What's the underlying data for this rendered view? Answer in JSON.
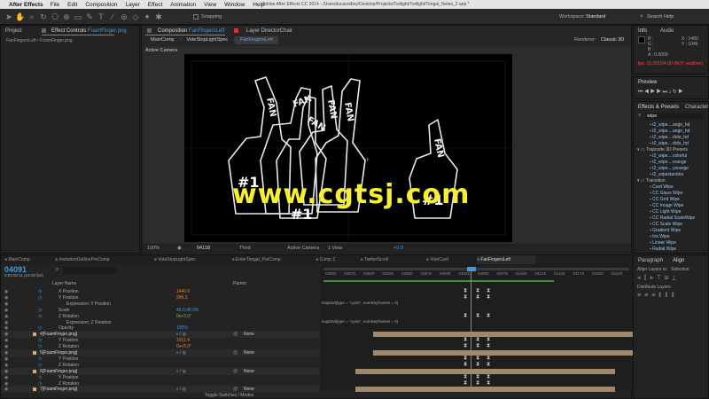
{
  "menubar": {
    "app": "After Effects",
    "items": [
      "File",
      "Edit",
      "Composition",
      "Layer",
      "Effect",
      "Animation",
      "View",
      "Window",
      "Help"
    ],
    "title": "Adobe After Effects CC 2014 - /Users/lucasridley/Desktop/Projects/Twilight/Twilight/Tongal_Notes_2.aep *"
  },
  "toolbar": {
    "snapping": "Snapping",
    "workspace_label": "Workspace:",
    "workspace_value": "Standard",
    "search_placeholder": "Search Help"
  },
  "project": {
    "tab": "Project",
    "effect_tab": "Effect Controls",
    "effect_target": "FoamFinger.png",
    "subtitle": "FanFingersLeft • FoamFinger.png"
  },
  "composition": {
    "tab": "Composition",
    "tab_name": "FanFingersLeft",
    "layer_tab": "Layer DirectorChair",
    "breadcrumbs": [
      "MainComp",
      "VoteStopLightSpec",
      "FanFingersLeft"
    ],
    "renderer_label": "Renderer:",
    "renderer_value": "Classic 3D",
    "active_camera": "Active Camera",
    "viewer_words": [
      "FAN",
      "FAN",
      "FAN",
      "FAN",
      "FAN",
      "FAN"
    ],
    "watermark": "www.cgtsj.com",
    "footer": {
      "zoom": "100%",
      "timecode": "04118",
      "resolution": "Third",
      "camera": "Active Camera",
      "view": "1 View",
      "exposure": "+0.0"
    }
  },
  "info": {
    "tab": "Info",
    "audio_tab": "Audio",
    "r": "R :",
    "g": "G :",
    "b": "B :",
    "a": "A : 0.0000",
    "x": "X : 1480",
    "y": "Y : 1046",
    "fps": "fps: 15.201/24.00 (NOT realtime)"
  },
  "preview": {
    "tab": "Preview"
  },
  "effects": {
    "tab": "Effects & Presets",
    "tab2": "Character",
    "search": "wipe",
    "items": [
      "t2_wipe....ange_hd",
      "t2_wipe....ange_hd",
      "t2_wipe....dots_hd",
      "t2_wipe....dots_hd",
      "Trapcode 3D Presets",
      "t2_wipe....colorful",
      "t2_wipe....orange",
      "t2_wipe....yorange",
      "t2_wipestardots",
      "Transition",
      "Card Wipe",
      "CC Glass Wipe",
      "CC Grid Wipe",
      "CC Image Wipe",
      "CC Light Wipe",
      "CC Radial ScaleWipe",
      "CC Scale Wipe",
      "Gradient Wipe",
      "Iris Wipe",
      "Linear Wipe",
      "Radial Wipe"
    ]
  },
  "timeline": {
    "tabs": [
      "MainComp",
      "InvitationOutlinePreComp",
      "VoteStopLightSpec",
      "EnterTongal_PreComp",
      "Comp 2",
      "TwitterScroll",
      "VoteCard",
      "FanFingersLeft"
    ],
    "timecode": "04091",
    "timecode_sub": "0:02:50:11 (24.00 fps)",
    "search_placeholder": "",
    "col_layer": "Layer Name",
    "col_parent": "Parent",
    "ruler": [
      "03850",
      "03875",
      "03900",
      "03925",
      "03950",
      "03975",
      "04000",
      "04025",
      "04050",
      "04075",
      "04100",
      "04125",
      "04150",
      "04175",
      "04200",
      "04225"
    ],
    "rows": [
      {
        "indent": 3,
        "name": "X Position",
        "value": "1440.0",
        "color": "#e08a2b"
      },
      {
        "indent": 3,
        "name": "Y Position",
        "value": "999.2",
        "color": "#e08a2b"
      },
      {
        "indent": 4,
        "name": "Expression: Y Position",
        "value": "",
        "color": ""
      },
      {
        "indent": 3,
        "name": "Scale",
        "value": "46.0,46.0%",
        "color": "#3b9ae1"
      },
      {
        "indent": 3,
        "name": "Z Rotation",
        "value": "0x+3.0°",
        "color": "#e08a2b"
      },
      {
        "indent": 4,
        "name": "Expression: Z Rotation",
        "value": "",
        "color": ""
      },
      {
        "indent": 3,
        "name": "Opacity",
        "value": "100%",
        "color": "#3b9ae1"
      },
      {
        "indent": 1,
        "name": "[FoamFinger.png]",
        "value": "",
        "color": "",
        "num": "4",
        "parent": "None"
      },
      {
        "indent": 3,
        "name": "Y Position",
        "value": "1011.4",
        "color": "#e08a2b"
      },
      {
        "indent": 3,
        "name": "Z Rotation",
        "value": "0x+5.0°",
        "color": "#e08a2b"
      },
      {
        "indent": 1,
        "name": "[FoamFinger.png]",
        "value": "",
        "color": "",
        "num": "5",
        "parent": "None"
      },
      {
        "indent": 3,
        "name": "Y Position",
        "value": "",
        "color": "#e08a2b"
      },
      {
        "indent": 3,
        "name": "Z Rotation",
        "value": "",
        "color": "#e08a2b"
      },
      {
        "indent": 1,
        "name": "[FoamFinger.png]",
        "value": "",
        "color": "",
        "num": "6",
        "parent": "None"
      },
      {
        "indent": 3,
        "name": "Y Position",
        "value": "",
        "color": "#e08a2b"
      },
      {
        "indent": 3,
        "name": "Z Rotation",
        "value": "",
        "color": "#e08a2b"
      },
      {
        "indent": 1,
        "name": "[FoamFinger.png]",
        "value": "",
        "color": "",
        "num": "7",
        "parent": "None"
      }
    ],
    "expressions": [
      "loopOut(type = \"cycle\", numKeyframes = 0)",
      "loopOut(type = \"cycle\", numKeyframes = 0)"
    ],
    "footer": "Toggle Switches / Modes"
  },
  "paragraph": {
    "tab": "Paragraph",
    "align_tab": "Align",
    "align_to_label": "Align Layers to:",
    "align_to_value": "Selection",
    "distribute_label": "Distribute Layers:"
  }
}
